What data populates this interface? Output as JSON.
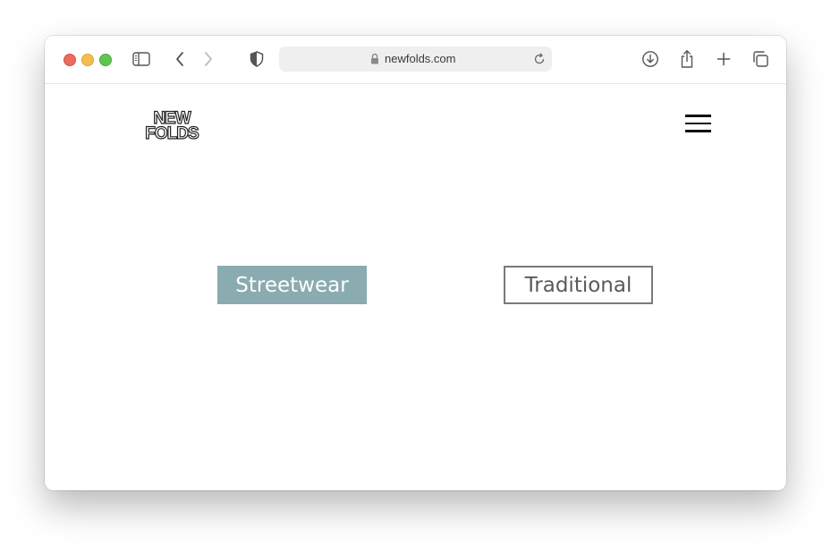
{
  "browser": {
    "url": "newfolds.com",
    "icons": {
      "sidebar": "sidebar-icon",
      "back": "chevron-left-icon",
      "forward": "chevron-right-icon",
      "privacy": "shield-icon",
      "lock": "lock-icon",
      "reload": "reload-icon",
      "download": "download-icon",
      "share": "share-icon",
      "new_tab": "plus-icon",
      "tabs": "tabs-overview-icon"
    }
  },
  "site": {
    "logo": {
      "line1": "NEW",
      "line2": "FOLDS"
    },
    "menu_icon": "hamburger-menu-icon",
    "categories": [
      {
        "label": "Streetwear",
        "style": "filled",
        "color": "#8aabb0"
      },
      {
        "label": "Traditional",
        "style": "outlined",
        "color": "#7a7a7a"
      }
    ]
  }
}
